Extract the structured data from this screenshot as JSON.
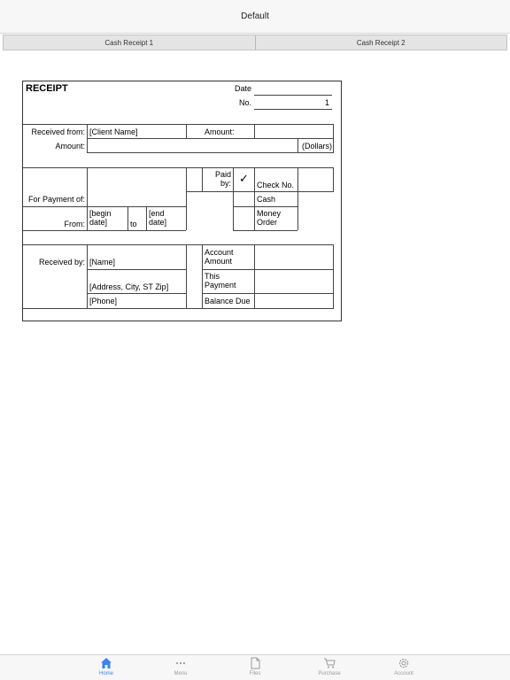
{
  "app": {
    "title": "Default"
  },
  "sheet_tabs": [
    {
      "label": "Cash Receipt 1"
    },
    {
      "label": "Cash Receipt 2"
    }
  ],
  "receipt": {
    "title": "RECEIPT",
    "date_label": "Date",
    "date_value": "",
    "no_label": "No.",
    "no_value": "1",
    "received_from_label": "Received from:",
    "client_name": "[Client Name]",
    "amount_label": "Amount:",
    "amount_value": "",
    "amount_words_label": "Amount:",
    "dollars_label": "(Dollars)",
    "paid_by_label": "Paid by:",
    "check_mark": "✓",
    "check_no_label": "Check No.",
    "cash_label": "Cash",
    "money_order_label": "Money Order",
    "for_payment_label": "For Payment of:",
    "from_label": "From:",
    "begin_date": "[begin date]",
    "to_label": "to",
    "end_date": "[end date]",
    "received_by_label": "Received by:",
    "name": "[Name]",
    "address": "[Address, City, ST  Zip]",
    "phone": "[Phone]",
    "account_amount_label": "Account Amount",
    "this_payment_label": "This Payment",
    "balance_due_label": "Balance Due"
  },
  "bottom_nav": [
    {
      "label": "Home",
      "icon": "home-icon",
      "active": true
    },
    {
      "label": "Menu",
      "icon": "more-icon",
      "active": false
    },
    {
      "label": "Files",
      "icon": "file-icon",
      "active": false
    },
    {
      "label": "Purchase",
      "icon": "cart-icon",
      "active": false
    },
    {
      "label": "Account",
      "icon": "gear-icon",
      "active": false
    }
  ],
  "colors": {
    "accent": "#3b82f6",
    "inactive": "#9a9a9a"
  }
}
